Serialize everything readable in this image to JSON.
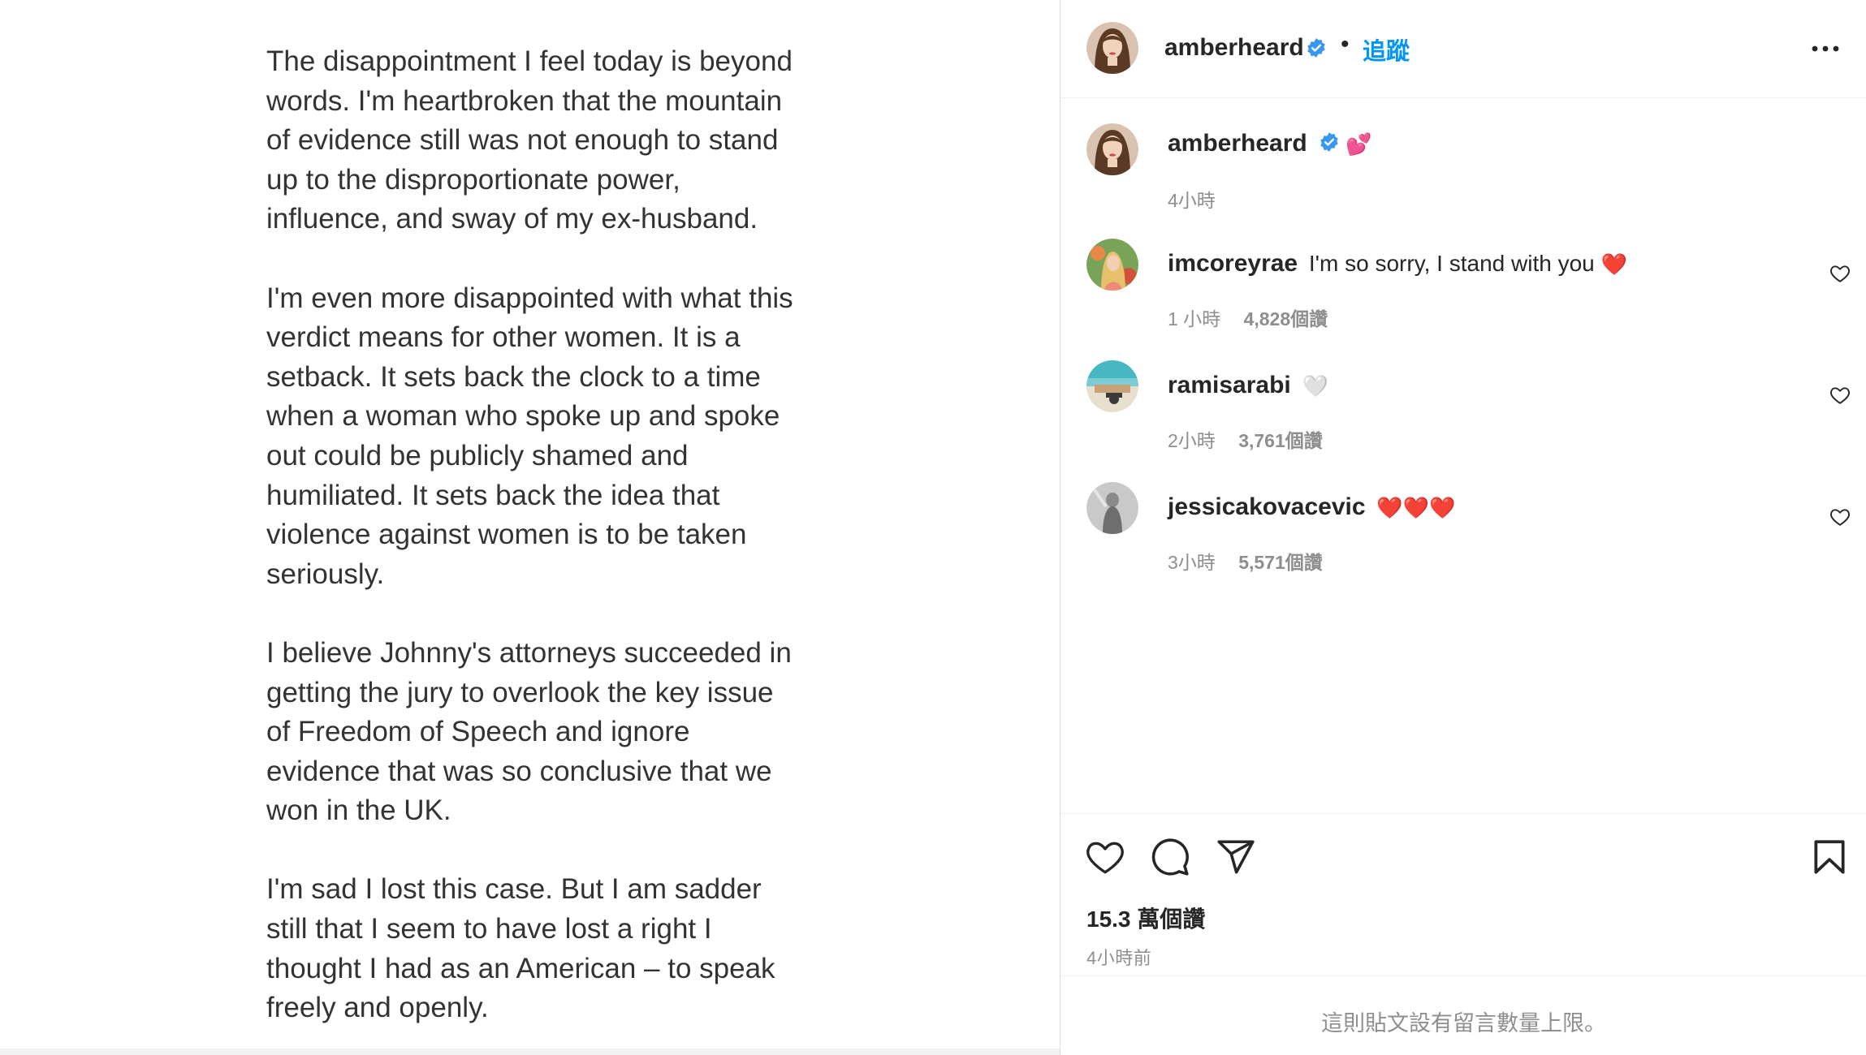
{
  "post_image": {
    "paragraphs": [
      "The disappointment I feel today is beyond\nwords. I'm heartbroken that the mountain\nof evidence still was not enough to stand\nup to the disproportionate power,\ninfluence, and sway of my ex-husband.",
      "I'm even more disappointed with what this\nverdict means for other women. It is a\nsetback. It sets back the clock to a time\nwhen a woman who spoke up and spoke\nout could be publicly shamed and\nhumiliated. It sets back the idea that\nviolence against women is to be taken\nseriously.",
      "I believe Johnny's attorneys succeeded in\ngetting the jury to overlook the key issue\nof Freedom of Speech and ignore\nevidence that was so conclusive that we\nwon in the UK.",
      "I'm sad I lost this case. But I am sadder\nstill that I seem to have lost a right I\nthought I had as an American – to speak\nfreely and openly."
    ]
  },
  "header": {
    "username": "amberheard",
    "separator": "•",
    "follow_label": "追蹤"
  },
  "caption": {
    "username": "amberheard",
    "emoji": "💕",
    "time": "4小時"
  },
  "comments": [
    {
      "username": "imcoreyrae",
      "text": "I'm so sorry, I stand with you",
      "emoji": "❤️",
      "time": "1 小時",
      "likes": "4,828個讚"
    },
    {
      "username": "ramisarabi",
      "text": "",
      "emoji": "🤍",
      "time": "2小時",
      "likes": "3,761個讚"
    },
    {
      "username": "jessicakovacevic",
      "text": "",
      "emoji": "❤️❤️❤️",
      "time": "3小時",
      "likes": "5,571個讚"
    }
  ],
  "footer": {
    "likes_total": "15.3 萬個讚",
    "time_ago": "4小時前",
    "comment_limit_notice": "這則貼文設有留言數量上限。"
  },
  "colors": {
    "accent": "#0095f6",
    "verified": "#3897f0",
    "muted": "#8e8e8e",
    "heart_red": "#ed4956"
  },
  "icons": [
    "verified-badge-icon",
    "more-options-icon",
    "heart-icon",
    "comment-icon",
    "share-icon",
    "bookmark-icon"
  ]
}
